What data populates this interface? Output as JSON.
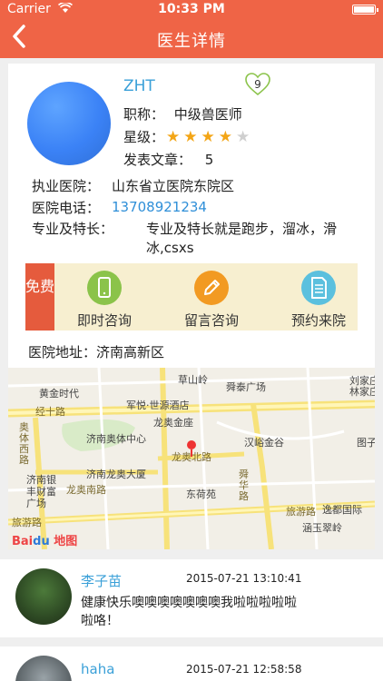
{
  "status_bar": {
    "carrier": "Carrier",
    "time": "10:33 PM"
  },
  "nav": {
    "title": "医生详情",
    "back_icon": "chevron-left-icon"
  },
  "doctor": {
    "name": "ZHT",
    "likes": "9",
    "title_label": "职称：",
    "title_value": "中级兽医师",
    "rating_label": "星级：",
    "rating": 4,
    "rating_max": 5,
    "articles_label": "发表文章：",
    "articles_value": "5",
    "hospital_label": "执业医院：",
    "hospital_value": "山东省立医院东院区",
    "phone_label": "医院电话：",
    "phone_value": "13708921234",
    "specialty_label": "专业及特长：",
    "specialty_value": "专业及特长就是跑步，溜冰，滑冰,csxs",
    "address_label": "医院地址：",
    "address_value": "济南高新区"
  },
  "services": {
    "free_label": "免费",
    "items": [
      {
        "label": "即时咨询",
        "icon": "phone-icon",
        "color": "#8bc34a"
      },
      {
        "label": "留言咨询",
        "icon": "pencil-icon",
        "color": "#f29a22"
      },
      {
        "label": "预约来院",
        "icon": "document-icon",
        "color": "#5bc0de"
      }
    ]
  },
  "map": {
    "places": [
      "草山岭",
      "舜泰广场",
      "刘家庄",
      "黄金时代",
      "军悦·世源酒店",
      "林家庄",
      "龙奥金座",
      "汉峪金谷",
      "济南奥体中心",
      "图子",
      "济南龙奥大厦",
      "东荷苑",
      "济南银丰财富广场",
      "逸都国际",
      "涵玉翠岭"
    ],
    "roads": [
      "经十路",
      "奥体西路",
      "龙奥北路",
      "龙奥南路",
      "舜华路",
      "旅游路",
      "旅游路"
    ],
    "logo": "Bai地图"
  },
  "comments": [
    {
      "name": "李子苗",
      "time": "2015-07-21 13:10:41",
      "text": "健康快乐噢噢噢噢噢噢噢我啦啦啦啦啦啦咯！"
    },
    {
      "name": "haha",
      "time": "2015-07-21 12:58:58",
      "text": ""
    }
  ],
  "colors": {
    "brand": "#ef6446",
    "link": "#3aa0d8",
    "star": "#f3a516",
    "free_tag": "#e55b3d",
    "service_bg": "#f7efd0"
  }
}
